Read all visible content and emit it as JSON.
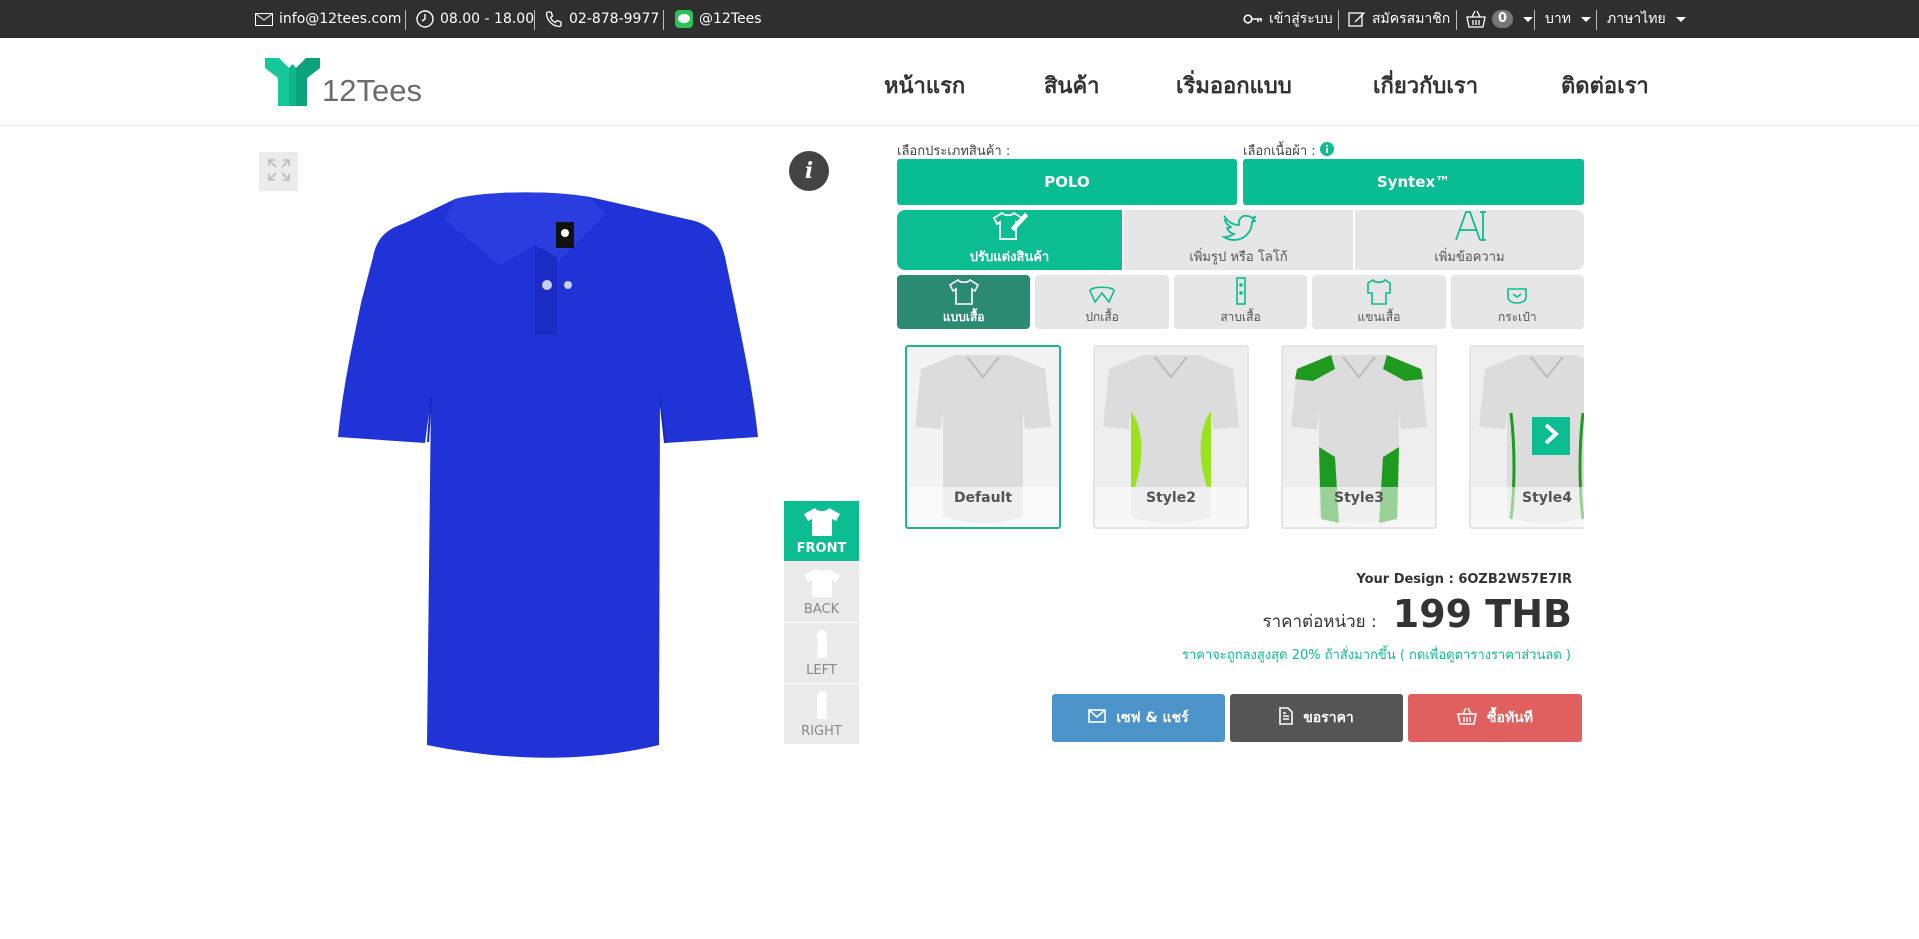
{
  "topbar": {
    "email": "info@12tees.com",
    "hours": "08.00 - 18.00",
    "phone": "02-878-9977",
    "line": "@12Tees",
    "login": "เข้าสู่ระบบ",
    "register": "สมัครสมาชิก",
    "cart_count": "0",
    "currency": "บาท",
    "language": "ภาษาไทย"
  },
  "header": {
    "logo_text": "12Tees",
    "nav": [
      "หน้าแรก",
      "สินค้า",
      "เริ่มออกแบบ",
      "เกี่ยวกับเรา",
      "ติดต่อเรา"
    ]
  },
  "preview": {
    "info_glyph": "i",
    "shirt_color": "#1f33d6",
    "views": [
      "FRONT",
      "BACK",
      "LEFT",
      "RIGHT"
    ],
    "active_view": "FRONT"
  },
  "config": {
    "product_type_label": "เลือกประเภทสินค้า :",
    "fabric_label": "เลือกเนื้อผ้า :",
    "product_type": "POLO",
    "fabric": "Syntex™",
    "modes": [
      "ปรับแต่งสินค้า",
      "เพิ่มรูป หรือ โลโก้",
      "เพิ่มข้อความ"
    ],
    "parts": [
      "แบบเสื้อ",
      "ปกเสื้อ",
      "สาบเสื้อ",
      "แขนเสื้อ",
      "กระเป๋า"
    ],
    "styles": [
      "Default",
      "Style2",
      "Style3",
      "Style4"
    ]
  },
  "summary": {
    "design_label": "Your Design : 6OZB2W57E7IR",
    "price_label": "ราคาต่อหน่วย :",
    "price": "199 THB",
    "discount_note": "ราคาจะถูกลงสูงสุด 20% ถ้าสั่งมากขึ้น ( กดเพื่อดูตารางราคาส่วนลด )"
  },
  "actions": {
    "save_share": "เซฟ & แชร์",
    "quote": "ขอราคา",
    "buy_now": "ซื้อทันที"
  },
  "colors": {
    "accent": "#0bbd90",
    "topbar": "#2f2f2f",
    "save_btn": "#4b93c9",
    "quote_btn": "#555555",
    "buy_btn": "#e0605f"
  }
}
